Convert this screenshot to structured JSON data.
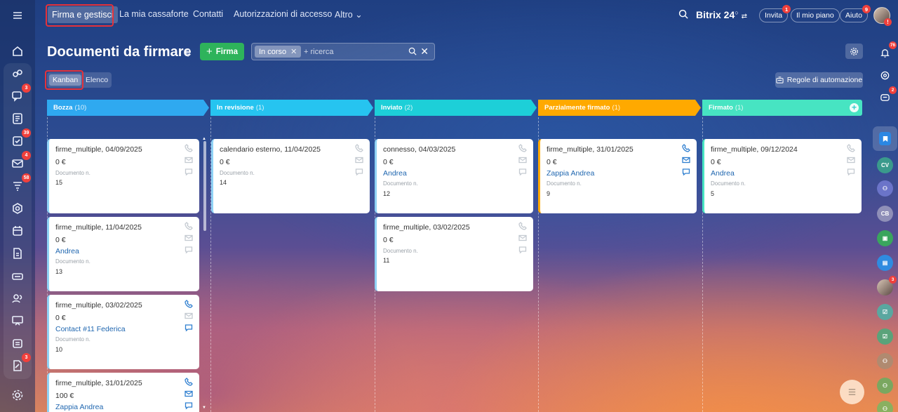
{
  "top_nav": {
    "tabs": [
      "Firma e gestisci",
      "La mia cassaforte",
      "Contatti",
      "Autorizzazioni di accesso",
      "Altro"
    ],
    "brand": "Bitrix 24",
    "invite": "Invita",
    "invite_badge": "1",
    "plan": "Il mio piano",
    "help": "Aiuto",
    "help_badge": "9"
  },
  "header": {
    "title": "Documenti da firmare",
    "add_button": "Firma",
    "filter_chip": "In corso",
    "search_placeholder": "+ ricerca",
    "view_kanban": "Kanban",
    "view_list": "Elenco",
    "automation": "Regole di automazione"
  },
  "sidebar_badges": {
    "chat": "3",
    "tasks": "39",
    "mail": "4",
    "feed": "58",
    "sign": "3"
  },
  "right_badges": {
    "notifications": "76",
    "chat": "2",
    "avatar": "3"
  },
  "right_initials": {
    "cv": "CV",
    "cb": "CB"
  },
  "columns": [
    {
      "name": "Bozza",
      "count": "(10)",
      "color": "#2fa9f0"
    },
    {
      "name": "In revisione",
      "count": "(1)",
      "color": "#26c4f0"
    },
    {
      "name": "Inviato",
      "count": "(2)",
      "color": "#1dcfd8"
    },
    {
      "name": "Parzialmente firmato",
      "count": "(1)",
      "color": "#ffa900"
    },
    {
      "name": "Firmato",
      "count": "(1)",
      "color": "#47e4c2"
    }
  ],
  "doc_label": "Documento n.",
  "cards": {
    "c0_0": {
      "title": "firme_multiple, 04/09/2025",
      "amount": "0 €",
      "contact": "",
      "number": "15"
    },
    "c0_1": {
      "title": "firme_multiple, 11/04/2025",
      "amount": "0 €",
      "contact": "Andrea",
      "number": "13"
    },
    "c0_2": {
      "title": "firme_multiple, 03/02/2025",
      "amount": "0 €",
      "contact": "Contact #11 Federica",
      "number": "10"
    },
    "c0_3": {
      "title": "firme_multiple, 31/01/2025",
      "amount": "100 €",
      "contact": "Zappia Andrea",
      "number": ""
    },
    "c1_0": {
      "title": "calendario esterno, 11/04/2025",
      "amount": "0 €",
      "contact": "",
      "number": "14"
    },
    "c2_0": {
      "title": "connesso, 04/03/2025",
      "amount": "0 €",
      "contact": "Andrea",
      "number": "12"
    },
    "c2_1": {
      "title": "firme_multiple, 03/02/2025",
      "amount": "0 €",
      "contact": "",
      "number": "11"
    },
    "c3_0": {
      "title": "firme_multiple, 31/01/2025",
      "amount": "0 €",
      "contact": "Zappia Andrea",
      "number": "9"
    },
    "c4_0": {
      "title": "firme_multiple, 09/12/2024",
      "amount": "0 €",
      "contact": "Andrea",
      "number": "5"
    }
  }
}
